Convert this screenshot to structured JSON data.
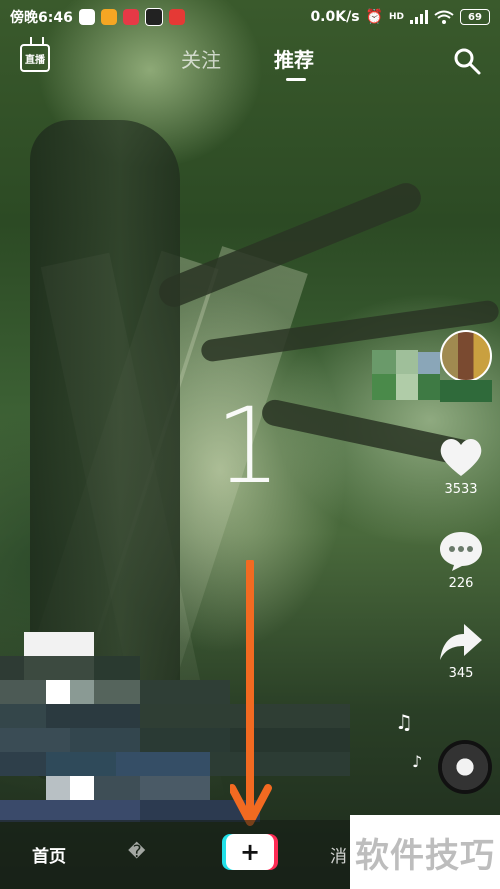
{
  "status_bar": {
    "time": "傍晚6:46",
    "network_speed": "0.0K/s",
    "network_type": "HD",
    "battery": "69"
  },
  "top_nav": {
    "live_label": "直播",
    "tabs": [
      {
        "label": "关注",
        "active": false
      },
      {
        "label": "推荐",
        "active": true
      }
    ]
  },
  "video": {
    "overlay_number": "1"
  },
  "actions": {
    "likes": "3533",
    "comments": "226",
    "shares": "345"
  },
  "bottom_nav": {
    "home": "首页",
    "partial_item": "�",
    "create": "+",
    "messages_partial": "消"
  },
  "watermark": "软件技巧",
  "colors": {
    "arrow": "#f26a21",
    "create_cyan": "#22e0e8",
    "create_red": "#fe2c55"
  }
}
